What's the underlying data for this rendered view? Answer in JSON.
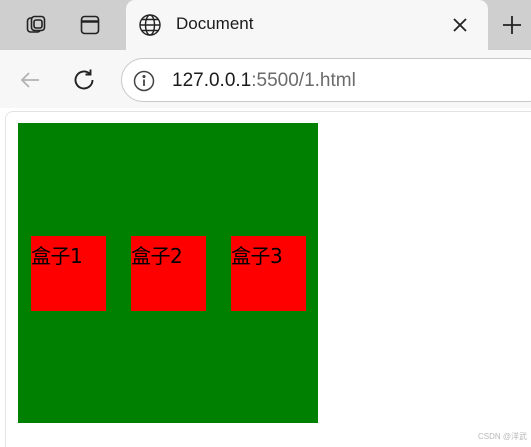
{
  "tab": {
    "title": "Document",
    "close_symbol": "×",
    "new_tab_symbol": "+"
  },
  "toolbar": {
    "url_host": "127.0.0.1",
    "url_path": ":5500/1.html"
  },
  "icons": {
    "workspaces": "workspaces-icon",
    "tab_actions": "tab-actions-icon",
    "globe": "globe-icon",
    "back": "back-arrow-icon",
    "refresh": "refresh-icon",
    "info": "info-icon"
  },
  "page": {
    "outer_color": "#008000",
    "child_color": "#ff0000",
    "boxes": [
      "盒子1",
      "盒子2",
      "盒子3"
    ]
  },
  "watermark": "CSDN @洋武"
}
